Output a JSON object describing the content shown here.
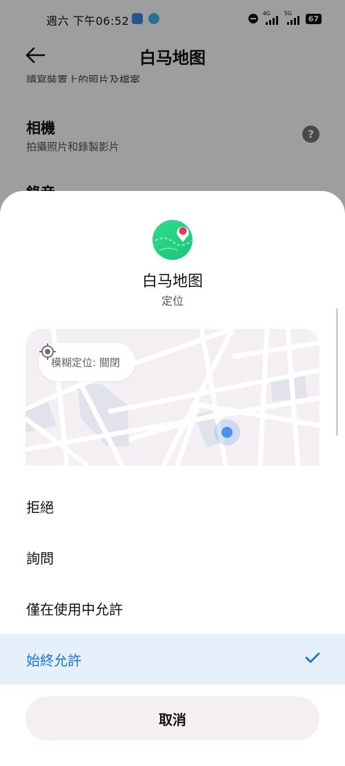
{
  "status_bar": {
    "time": "週六 下午06:52",
    "net1": "4G",
    "net2": "5G",
    "battery": "67"
  },
  "header": {
    "title": "白马地图"
  },
  "background": {
    "cut_text": "讀寫裝置上的照片及檔案",
    "items": [
      {
        "title": "相機",
        "desc": "拍攝照片和錄製影片"
      },
      {
        "title": "錄音",
        "desc": ""
      }
    ]
  },
  "sheet": {
    "app_name": "白马地图",
    "permission_name": "定位",
    "fuzzy_location": "模糊定位: 關閉",
    "options": [
      {
        "label": "拒絕",
        "selected": false
      },
      {
        "label": "詢問",
        "selected": false
      },
      {
        "label": "僅在使用中允許",
        "selected": false
      },
      {
        "label": "始終允許",
        "selected": true
      }
    ],
    "cancel_label": "取消"
  },
  "colors": {
    "accent": "#1a73d9",
    "selected_bg": "#e6f0fb",
    "logo_green": "#2fdc8a",
    "location_dot": "#4a90f0"
  }
}
